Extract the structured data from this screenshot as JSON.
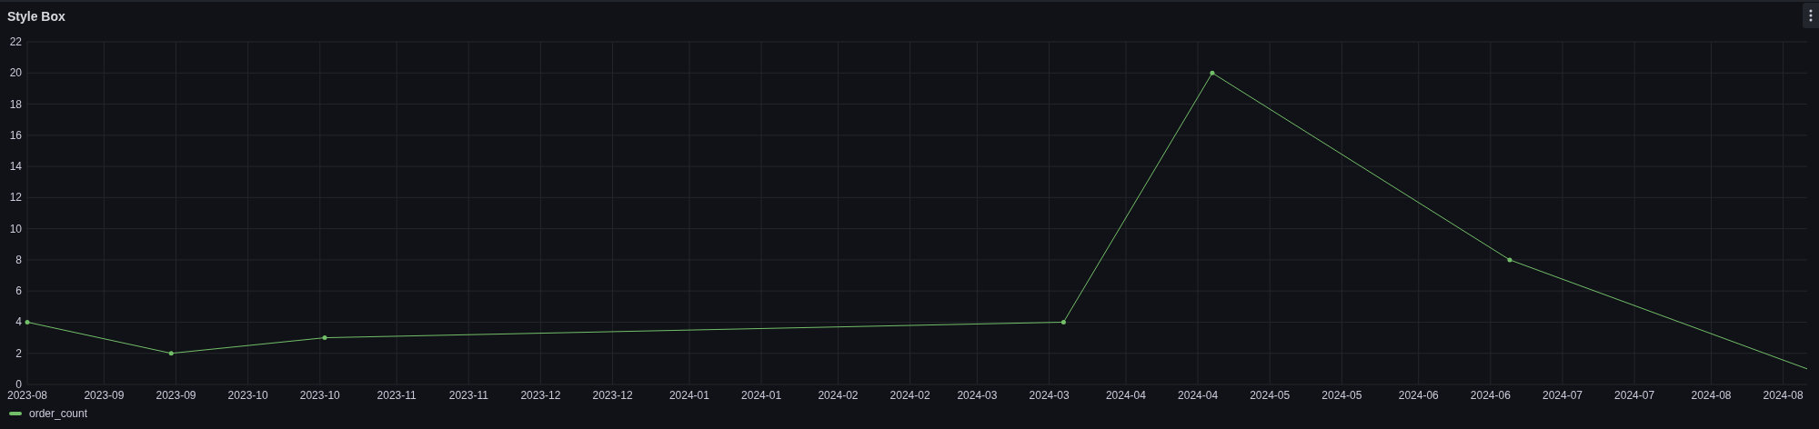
{
  "panel": {
    "title": "Style Box",
    "chart_data": {
      "type": "line",
      "grid": true,
      "x": [
        "2023-08-16",
        "2023-09-15",
        "2023-10-17",
        "2024-03-19",
        "2024-04-19",
        "2024-06-20",
        "2024-08-21"
      ],
      "series": [
        {
          "name": "order_count",
          "color": "#73bf69",
          "values": [
            4,
            2,
            3,
            4,
            20,
            8,
            1
          ]
        }
      ],
      "xlim": [
        "2023-08-16",
        "2024-08-21"
      ],
      "ylim": [
        0,
        22
      ],
      "xticks": [
        {
          "value": "2023-08-16",
          "label": "2023-08"
        },
        {
          "value": "2023-09-01",
          "label": "2023-09"
        },
        {
          "value": "2023-09-16",
          "label": "2023-09"
        },
        {
          "value": "2023-10-01",
          "label": "2023-10"
        },
        {
          "value": "2023-10-16",
          "label": "2023-10"
        },
        {
          "value": "2023-11-01",
          "label": "2023-11"
        },
        {
          "value": "2023-11-16",
          "label": "2023-11"
        },
        {
          "value": "2023-12-01",
          "label": "2023-12"
        },
        {
          "value": "2023-12-16",
          "label": "2023-12"
        },
        {
          "value": "2024-01-01",
          "label": "2024-01"
        },
        {
          "value": "2024-01-16",
          "label": "2024-01"
        },
        {
          "value": "2024-02-01",
          "label": "2024-02"
        },
        {
          "value": "2024-02-16",
          "label": "2024-02"
        },
        {
          "value": "2024-03-01",
          "label": "2024-03"
        },
        {
          "value": "2024-03-16",
          "label": "2024-03"
        },
        {
          "value": "2024-04-01",
          "label": "2024-04"
        },
        {
          "value": "2024-04-16",
          "label": "2024-04"
        },
        {
          "value": "2024-05-01",
          "label": "2024-05"
        },
        {
          "value": "2024-05-16",
          "label": "2024-05"
        },
        {
          "value": "2024-06-01",
          "label": "2024-06"
        },
        {
          "value": "2024-06-16",
          "label": "2024-06"
        },
        {
          "value": "2024-07-01",
          "label": "2024-07"
        },
        {
          "value": "2024-07-16",
          "label": "2024-07"
        },
        {
          "value": "2024-08-01",
          "label": "2024-08"
        },
        {
          "value": "2024-08-16",
          "label": "2024-08"
        }
      ],
      "yticks": [
        0,
        2,
        4,
        6,
        8,
        10,
        12,
        14,
        16,
        18,
        20,
        22
      ]
    }
  }
}
